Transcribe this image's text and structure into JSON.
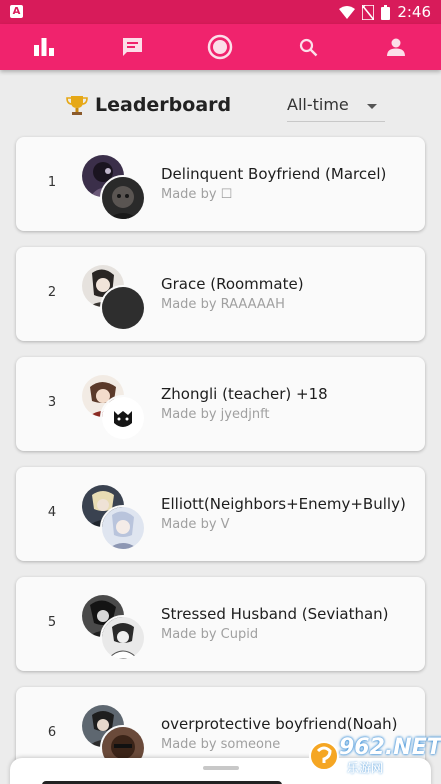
{
  "status_bar": {
    "app_icon_letter": "A",
    "time": "2:46",
    "icons": [
      "wifi-icon",
      "no-sim-icon",
      "battery-icon"
    ]
  },
  "nav": {
    "items": [
      {
        "icon": "leaderboard-icon",
        "active": true
      },
      {
        "icon": "chat-icon",
        "active": false
      },
      {
        "icon": "bubble-icon",
        "active": false
      },
      {
        "icon": "search-icon",
        "active": false
      },
      {
        "icon": "profile-icon",
        "active": false
      }
    ]
  },
  "header": {
    "title": "Leaderboard",
    "filter_value": "All-time"
  },
  "leaderboard": [
    {
      "rank": "1",
      "name": "Delinquent Boyfriend (Marcel)",
      "made_by": "Made by",
      "author": "☐"
    },
    {
      "rank": "2",
      "name": "Grace (Roommate)",
      "made_by": "Made by",
      "author": "RAAAAAH"
    },
    {
      "rank": "3",
      "name": "Zhongli (teacher) +18",
      "made_by": "Made by",
      "author": "jyedjnft"
    },
    {
      "rank": "4",
      "name": "Elliott(Neighbors+Enemy+Bully)",
      "made_by": "Made by",
      "author": "V"
    },
    {
      "rank": "5",
      "name": "Stressed Husband (Seviathan)",
      "made_by": "Made by",
      "author": "Cupid"
    },
    {
      "rank": "6",
      "name": "overprotective boyfriend(Noah)",
      "made_by": "Made by",
      "author": "someone"
    }
  ],
  "watermark": {
    "number": "962.NET",
    "subtitle": "乐游网"
  },
  "colors": {
    "accent": "#f0236d",
    "status_bar": "#d81b5a",
    "background": "#ececec",
    "card": "#fafafa"
  }
}
